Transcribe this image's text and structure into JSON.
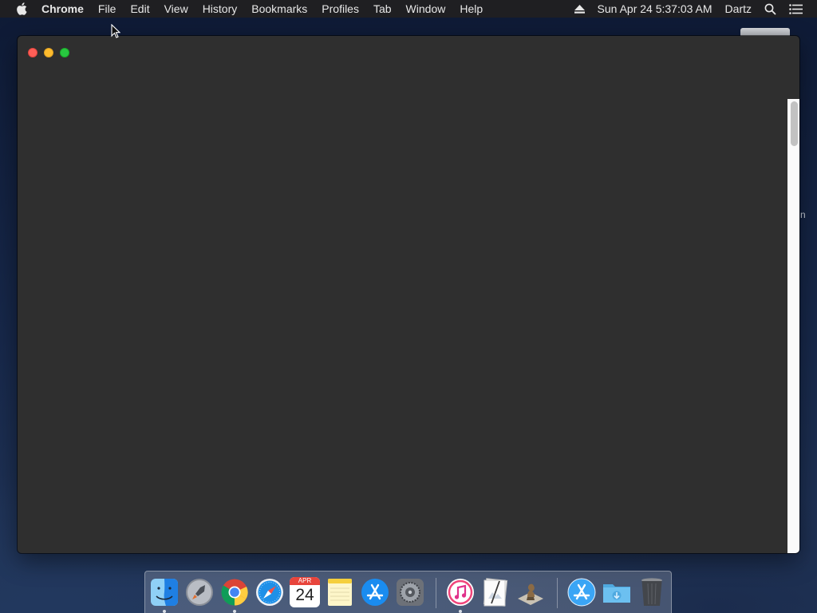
{
  "menubar": {
    "app_name": "Chrome",
    "menus": [
      "File",
      "Edit",
      "View",
      "History",
      "Bookmarks",
      "Profiles",
      "Tab",
      "Window",
      "Help"
    ],
    "datetime": "Sun Apr 24  5:37:03 AM",
    "user": "Dartz"
  },
  "desktop": {
    "partial_label": "n"
  },
  "window": {
    "title": ""
  },
  "dock": {
    "calendar_month": "APR",
    "calendar_day": "24",
    "apps": [
      "Finder",
      "Launchpad",
      "Google Chrome",
      "Safari",
      "Calendar",
      "Notes",
      "App Store",
      "System Preferences",
      "iTunes",
      "Preview",
      "Chess",
      "App Store",
      "Downloads",
      "Trash"
    ]
  }
}
